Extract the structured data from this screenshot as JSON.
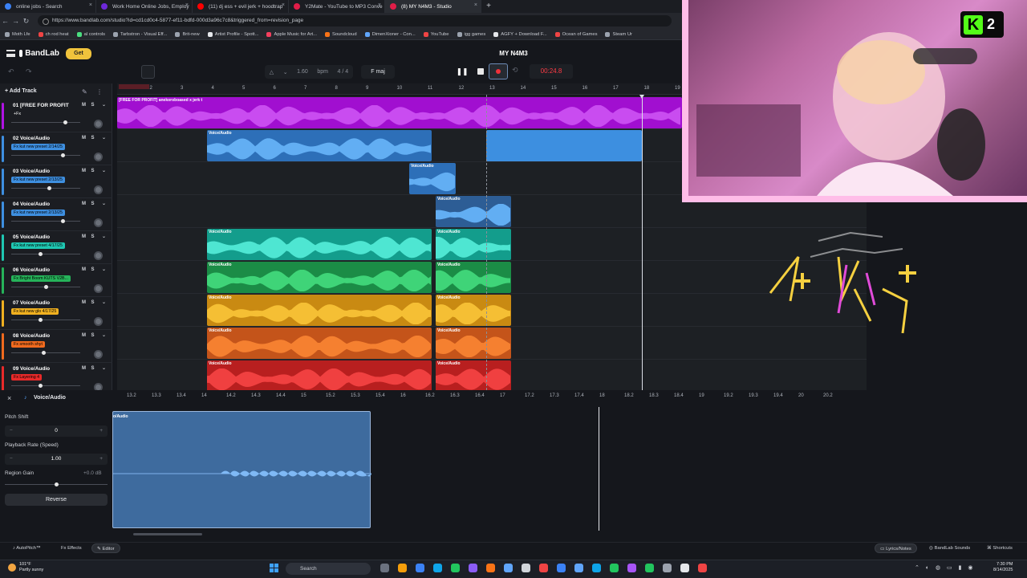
{
  "browser": {
    "tabs": [
      {
        "label": "online jobs - Search",
        "color": "#3b82f6"
      },
      {
        "label": "Work Home Online Jobs, Employ",
        "color": "#6d28d9"
      },
      {
        "label": "(11) dj ess + evil jerk + hoodtrap",
        "color": "#ff0000"
      },
      {
        "label": "Y2Mate - YouTube to MP3 Conve",
        "color": "#e11d48"
      },
      {
        "label": "(8) MY N4M3 - Studio",
        "color": "#e11d48"
      }
    ],
    "new_tab": "+",
    "url": "https://www.bandlab.com/studio?id=cd1cd0c4-5877-ef11-bdfd-000d3a96c7c8&triggered_from=revision_page",
    "bookmarks": [
      {
        "label": "Moth Lfe",
        "color": "#9ca3af"
      },
      {
        "label": "ch rod heat",
        "color": "#ef4444"
      },
      {
        "label": "al controls",
        "color": "#4ade80"
      },
      {
        "label": "Tarbstron - Visual Eff...",
        "color": "#9ca3af"
      },
      {
        "label": "Brit-new",
        "color": "#9ca3af"
      },
      {
        "label": "Artist Profile - Spott...",
        "color": "#e5e7eb"
      },
      {
        "label": "Apple Music for Art...",
        "color": "#f43f5e"
      },
      {
        "label": "Soundcloud",
        "color": "#f97316"
      },
      {
        "label": "DimenXioner - Con...",
        "color": "#60a5fa"
      },
      {
        "label": "YouTube",
        "color": "#ef4444"
      },
      {
        "label": "igg games",
        "color": "#9ca3af"
      },
      {
        "label": "AGFY + Download F...",
        "color": "#e5e7eb"
      },
      {
        "label": "Ocean of Games",
        "color": "#ef4444"
      },
      {
        "label": "Steam Ur",
        "color": "#9ca3af"
      }
    ]
  },
  "header": {
    "brand": "BandLab",
    "get_label": "Get",
    "project_title": "MY N4M3",
    "bpm_value": "1.60",
    "bpm_unit": "bpm",
    "time_sig": "4 / 4",
    "key": "F maj",
    "timecode": "00:24.8"
  },
  "left_panel": {
    "add_track": "Add Track",
    "mute": "M",
    "solo": "S",
    "tracks": [
      {
        "number": "01",
        "name": "[FREE FOR PROFIT] ...",
        "sub": "+Fx",
        "fx": "",
        "color": "#b013e3",
        "vol": 0.78,
        "pan": 0.5
      },
      {
        "number": "02",
        "name": "Voice/Audio",
        "sub": "",
        "fx": "Fx kut new preset 2/14/25",
        "color": "#3e8fe0",
        "vol": 0.74,
        "pan": 0.5
      },
      {
        "number": "03",
        "name": "Voice/Audio",
        "sub": "",
        "fx": "Fx kut new preset 2/13/25",
        "color": "#3e8fe0",
        "vol": 0.55,
        "pan": 0.5
      },
      {
        "number": "04",
        "name": "Voice/Audio",
        "sub": "",
        "fx": "Fx kut new preset 2/13/25",
        "color": "#3e8fe0",
        "vol": 0.74,
        "pan": 0.5
      },
      {
        "number": "05",
        "name": "Voice/Audio",
        "sub": "",
        "fx": "Fx kut new preset 4/17/25",
        "color": "#1fc7b2",
        "vol": 0.42,
        "pan": 0.5
      },
      {
        "number": "06",
        "name": "Voice/Audio",
        "sub": "",
        "fx": "Fx Bright Boom KUTS V2B...",
        "color": "#26b35a",
        "vol": 0.5,
        "pan": 0.5
      },
      {
        "number": "07",
        "name": "Voice/Audio",
        "sub": "",
        "fx": "Fx kut new glo 4/17/25",
        "color": "#f0b020",
        "vol": 0.42,
        "pan": 0.5
      },
      {
        "number": "08",
        "name": "Voice/Audio",
        "sub": "",
        "fx": "Fx smooth shyt",
        "color": "#f06a1e",
        "vol": 0.47,
        "pan": 0.5
      },
      {
        "number": "09",
        "name": "Voice/Audio",
        "sub": "",
        "fx": "Fx Layering 4",
        "color": "#e82a2a",
        "vol": 0.42,
        "pan": 0.5
      }
    ]
  },
  "timeline": {
    "bars": [
      "1",
      "2",
      "3",
      "4",
      "5",
      "6",
      "7",
      "8",
      "9",
      "10",
      "11",
      "12",
      "13",
      "14",
      "15",
      "16",
      "17",
      "18",
      "19"
    ],
    "beat_title": "[FREE FOR PROFIT] anekoroboased x jerk t",
    "clip_label": "Voice/Audio"
  },
  "editor": {
    "close": "×",
    "title": "Voice/Audio",
    "ruler": [
      "13.2",
      "13.3",
      "13.4",
      "14",
      "14.2",
      "14.3",
      "14.4",
      "15",
      "15.2",
      "15.3",
      "15.4",
      "16",
      "16.2",
      "16.3",
      "16.4",
      "17",
      "17.2",
      "17.3",
      "17.4",
      "18",
      "18.2",
      "18.3",
      "18.4",
      "19",
      "19.2",
      "19.3",
      "19.4",
      "20",
      "20.2"
    ],
    "pitch_shift_label": "Pitch Shift",
    "pitch_shift_value": "0",
    "playback_rate_label": "Playback Rate (Speed)",
    "playback_rate_value": "1.00",
    "region_gain_label": "Region Gain",
    "region_gain_value": "+0.0 dB",
    "region_gain_level": 0.5,
    "reverse_label": "Reverse",
    "clip_label": "o/Audio",
    "minus": "−",
    "plus": "+"
  },
  "footer": {
    "autopitch": "AutoPitch™",
    "effects": "Effects",
    "editor": "Editor",
    "lyrics": "Lyrics/Notes",
    "sounds": "BandLab Sounds",
    "shortcuts": "Shortcuts"
  },
  "overlay": {
    "kick_logo": "K",
    "kick_count": "2"
  },
  "taskbar": {
    "temperature": "101°F",
    "weather": "Partly sunny",
    "search_placeholder": "Search",
    "time": "7:30 PM",
    "date": "8/14/2025"
  }
}
